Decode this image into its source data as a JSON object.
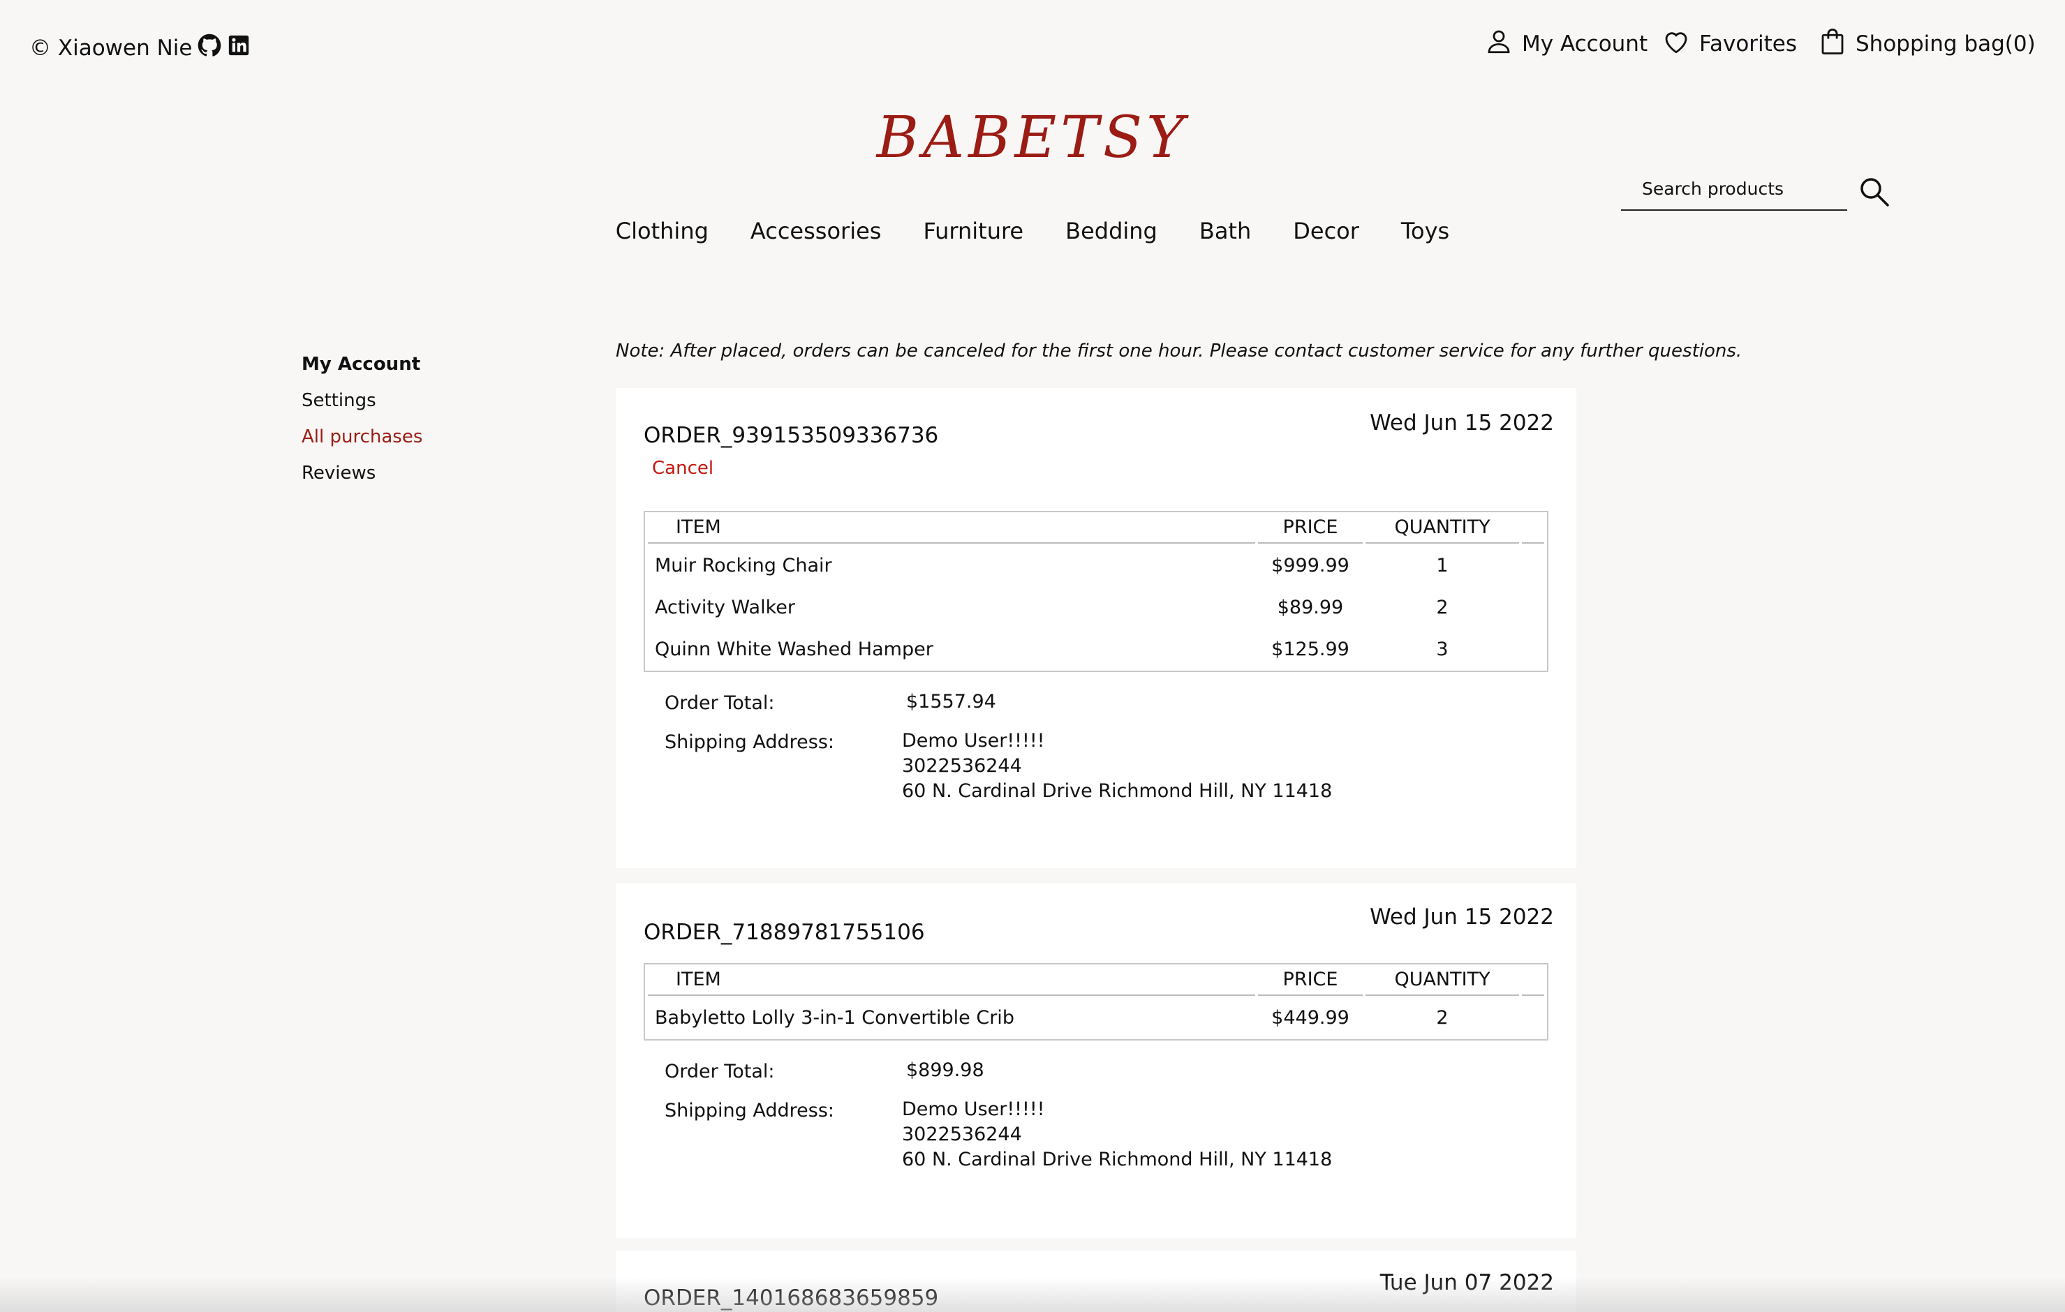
{
  "header": {
    "credit": "© Xiaowen Nie",
    "credit_icons": [
      "github-icon",
      "linkedin-icon"
    ],
    "account_label": "My Account",
    "favorites_label": "Favorites",
    "bag_label": "Shopping bag(0)",
    "brand": "BABETSY",
    "search_placeholder": "Search products",
    "categories": [
      "Clothing",
      "Accessories",
      "Furniture",
      "Bedding",
      "Bath",
      "Decor",
      "Toys"
    ]
  },
  "sidebar": {
    "heading": "My Account",
    "items": [
      "Settings",
      "All purchases",
      "Reviews"
    ],
    "active": "All purchases"
  },
  "note": "Note: After placed, orders can be canceled for the first one hour. Please contact customer service for any further questions.",
  "table_headers": {
    "item": "ITEM",
    "price": "PRICE",
    "quantity": "QUANTITY"
  },
  "labels": {
    "order_total": "Order Total:",
    "shipping_address": "Shipping Address:",
    "cancel": "Cancel"
  },
  "orders": [
    {
      "id": "ORDER_939153509336736",
      "date": "Wed Jun 15 2022",
      "cancelable": true,
      "items": [
        {
          "name": "Muir Rocking Chair",
          "price": "$999.99",
          "quantity": "1"
        },
        {
          "name": "Activity Walker",
          "price": "$89.99",
          "quantity": "2"
        },
        {
          "name": "Quinn White Washed Hamper",
          "price": "$125.99",
          "quantity": "3"
        }
      ],
      "total": "$1557.94",
      "address": {
        "name": "Demo User!!!!!",
        "phone": "3022536244",
        "street": "60 N. Cardinal Drive Richmond Hill, NY 11418"
      }
    },
    {
      "id": "ORDER_71889781755106",
      "date": "Wed Jun 15 2022",
      "cancelable": false,
      "items": [
        {
          "name": "Babyletto Lolly 3-in-1 Convertible Crib",
          "price": "$449.99",
          "quantity": "2"
        }
      ],
      "total": "$899.98",
      "address": {
        "name": "Demo User!!!!!",
        "phone": "3022536244",
        "street": "60 N. Cardinal Drive Richmond Hill, NY 11418"
      }
    },
    {
      "id": "ORDER_140168683659859",
      "date": "Tue Jun 07 2022"
    }
  ],
  "colors": {
    "brand": "#9b1c14",
    "cancel": "#c4170f",
    "background": "#f8f7f6",
    "card": "#ffffff"
  }
}
